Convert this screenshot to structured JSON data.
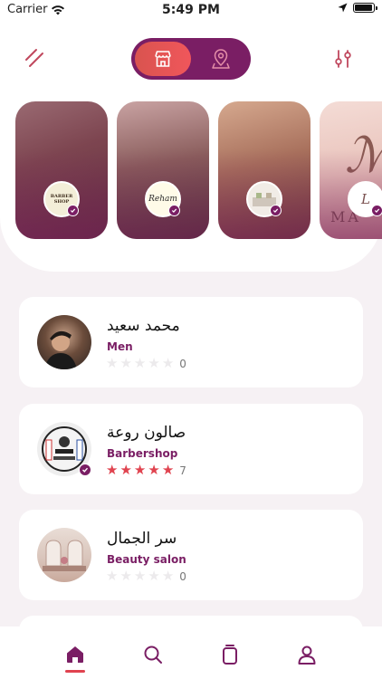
{
  "status_bar": {
    "carrier": "Carrier",
    "time": "5:49 PM",
    "battery_level": 0.95
  },
  "header": {
    "menu_icon": "menu-slash-icon",
    "filter_icon": "sliders-icon",
    "view_toggle": {
      "active": "store-icon",
      "inactive": "map-pin-icon"
    }
  },
  "stories": [
    {
      "logo_text": "BARBER SHOP",
      "verified": true
    },
    {
      "logo_text": "Reham",
      "verified": true
    },
    {
      "logo_text": "",
      "verified": true
    },
    {
      "logo_text": "L",
      "background_text": "MA",
      "verified": true
    }
  ],
  "salons": [
    {
      "name": "محمد سعيد",
      "category": "Men",
      "rating": 0,
      "reviews": "0",
      "verified": false
    },
    {
      "name": "صالون روعة",
      "category": "Barbershop",
      "rating": 5,
      "reviews": "7",
      "verified": true
    },
    {
      "name": "سر الجمال",
      "category": "Beauty salon",
      "rating": 0,
      "reviews": "0",
      "verified": false
    }
  ],
  "bottom_nav": [
    {
      "icon": "home-icon",
      "active": true
    },
    {
      "icon": "search-icon",
      "active": false
    },
    {
      "icon": "bookings-icon",
      "active": false
    },
    {
      "icon": "profile-icon",
      "active": false
    }
  ],
  "colors": {
    "brand": "#7a1e64",
    "accent": "#e0434f",
    "background": "#f6f1f4"
  }
}
